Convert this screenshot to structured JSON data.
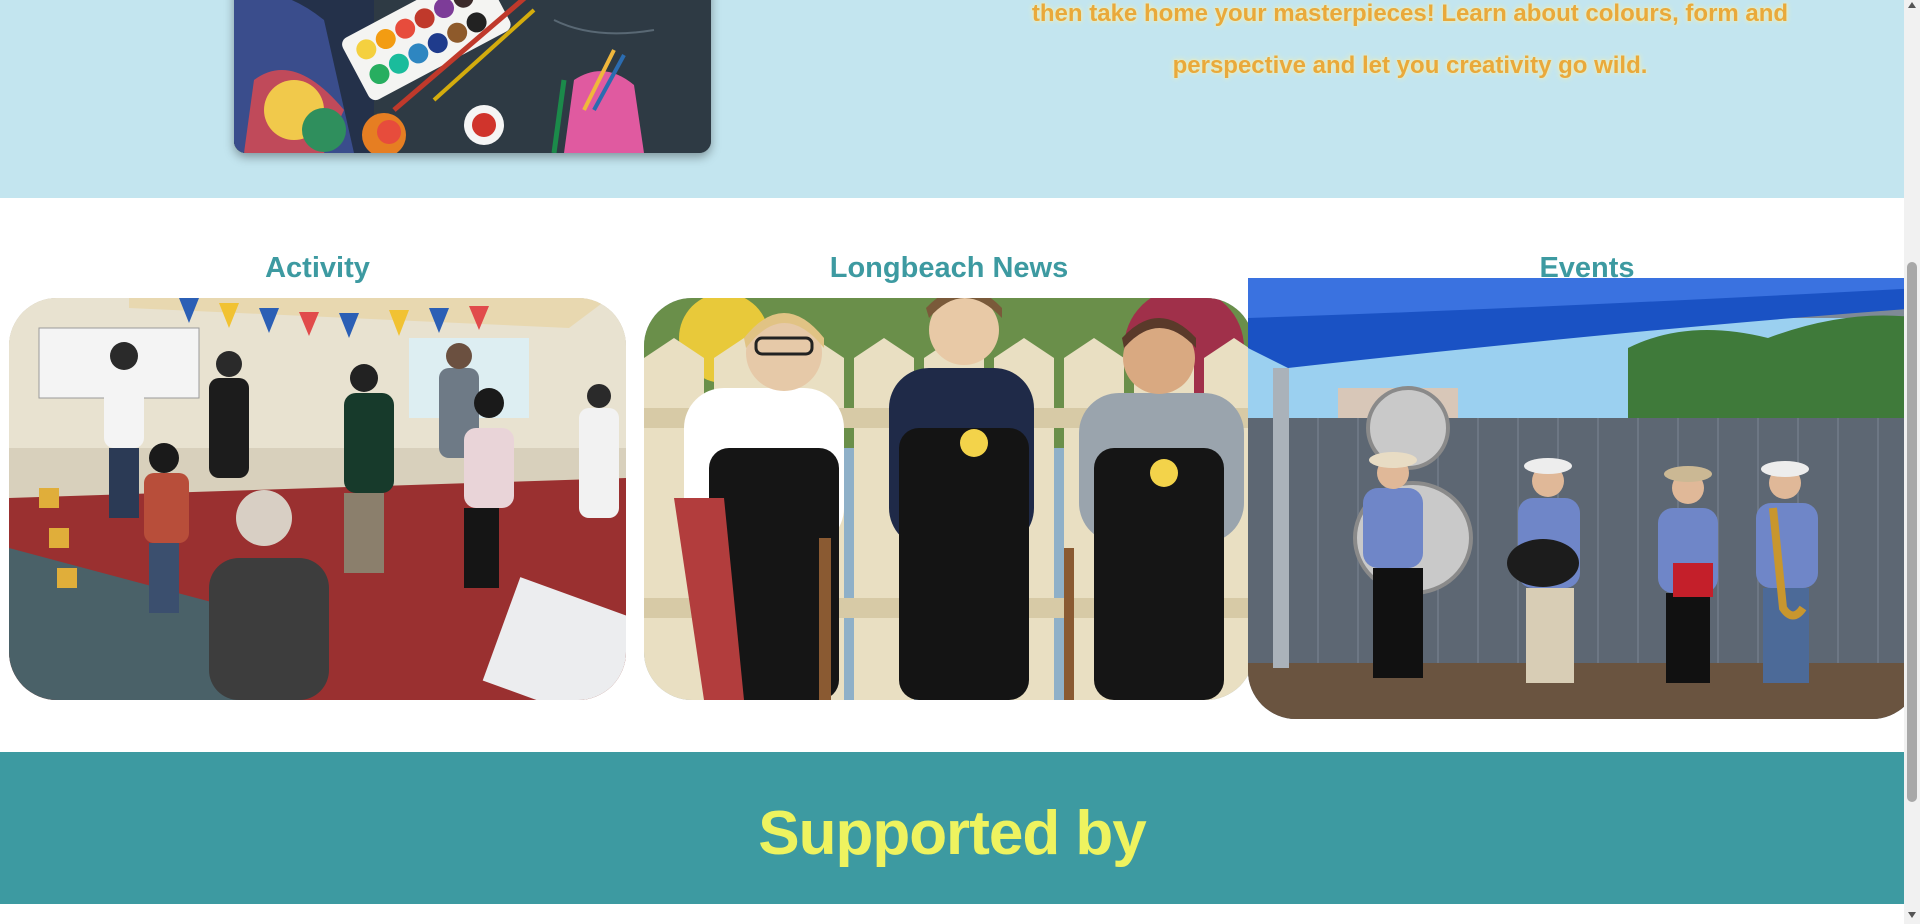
{
  "hero": {
    "lines": [
      "then take home your masterpieces! Learn about colours, form and",
      "perspective and let you creativity go wild."
    ]
  },
  "cards": [
    {
      "title": "Activity"
    },
    {
      "title": "Longbeach News"
    },
    {
      "title": "Events"
    }
  ],
  "support": {
    "title": "Supported by"
  },
  "colors": {
    "hero_bg": "#c3e5ef",
    "accent_teal": "#3d9aa1",
    "support_title": "#eef35f",
    "hero_text": "#e9a93b"
  }
}
